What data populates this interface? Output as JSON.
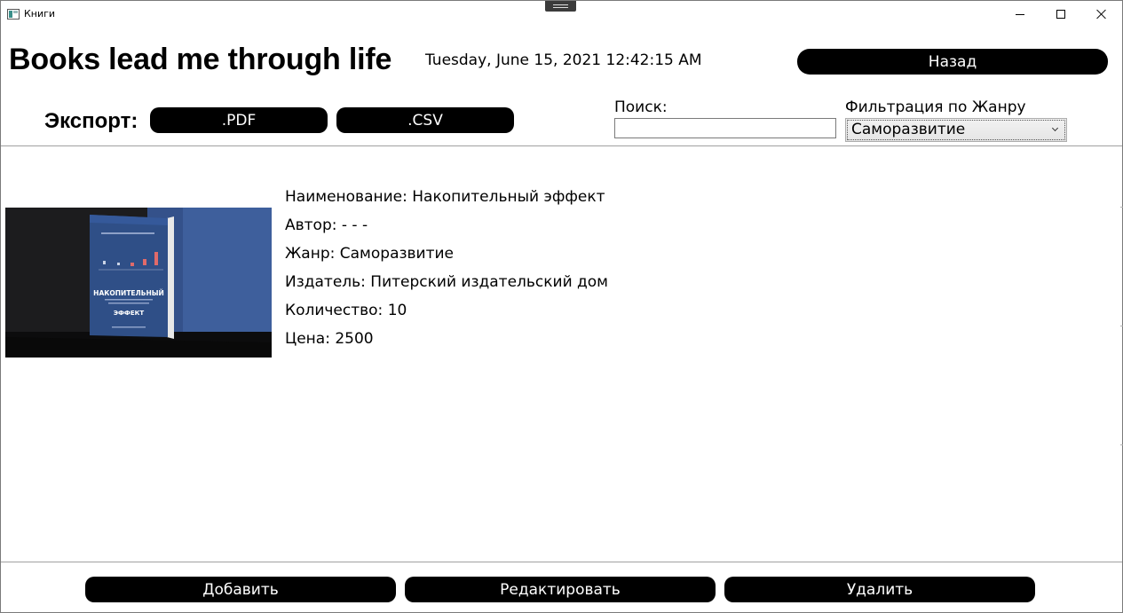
{
  "window": {
    "title": "Книги"
  },
  "header": {
    "title": "Books lead me through life",
    "datetime": "Tuesday, June 15, 2021 12:42:15 AM",
    "back_label": "Назад"
  },
  "export": {
    "label": "Экспорт:",
    "pdf_label": ".PDF",
    "csv_label": ".CSV"
  },
  "search": {
    "label": "Поиск:",
    "value": ""
  },
  "filter": {
    "label": "Фильтрация по Жанру",
    "selected": "Саморазвитие"
  },
  "books": [
    {
      "cover_text": {
        "title_line1": "НАКОПИТЕЛЬНЫЙ",
        "title_line2": "ЭФФЕКТ"
      },
      "name": "Наименование: Накопительный эффект",
      "author": "Автор: - - -",
      "genre": "Жанр: Саморазвитие",
      "publisher": "Издатель: Питерский издательский дом",
      "quantity": "Количество: 10",
      "price": "Цена: 2500"
    }
  ],
  "actions": {
    "add_label": "Добавить",
    "edit_label": "Редактировать",
    "delete_label": "Удалить"
  },
  "colors": {
    "button_bg": "#000000",
    "button_text": "#ffffff",
    "cover_blue": "#3e5f9c"
  },
  "icons": {
    "app": "app-window-icon",
    "minimize": "minimize-icon",
    "maximize": "maximize-icon",
    "close": "close-icon",
    "dropdown": "chevron-down-icon"
  }
}
